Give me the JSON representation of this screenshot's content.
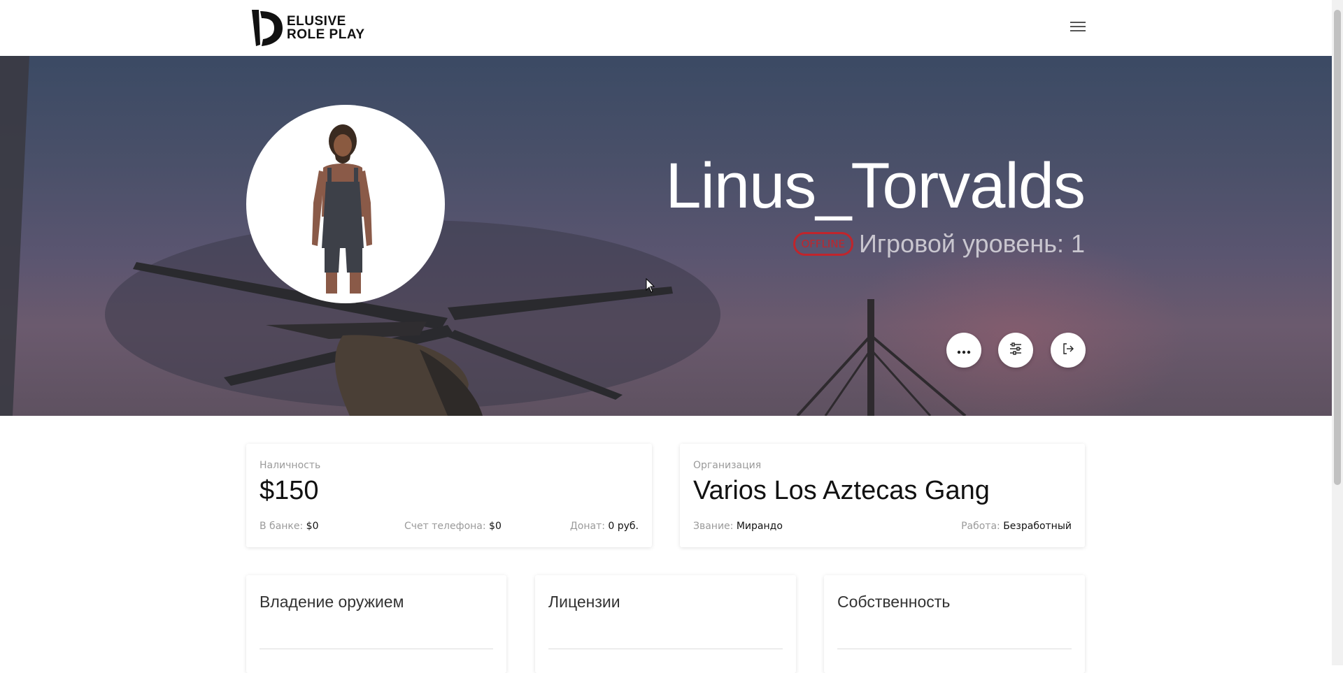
{
  "header": {
    "logo_line1": "ELUSIVE",
    "logo_line2": "ROLE PLAY"
  },
  "profile": {
    "username": "Linus_Torvalds",
    "status_badge": "OFFLINE",
    "level_text": "Игровой уровень: 1",
    "status_color": "#c0252c"
  },
  "actions": {
    "icons": [
      "more-icon",
      "settings-sliders-icon",
      "logout-icon"
    ]
  },
  "cash_card": {
    "label": "Наличность",
    "value": "$150",
    "bank_key": "В банке:",
    "bank_value": "$0",
    "phone_key": "Счет телефона:",
    "phone_value": "$0",
    "donate_key": "Донат:",
    "donate_value": "0 руб."
  },
  "org_card": {
    "label": "Организация",
    "value": "Varios Los Aztecas Gang",
    "rank_key": "Звание:",
    "rank_value": "Мирандо",
    "job_key": "Работа:",
    "job_value": "Безработный"
  },
  "sections": {
    "weapons_title": "Владение оружием",
    "licenses_title": "Лицензии",
    "property_title": "Собственность"
  }
}
